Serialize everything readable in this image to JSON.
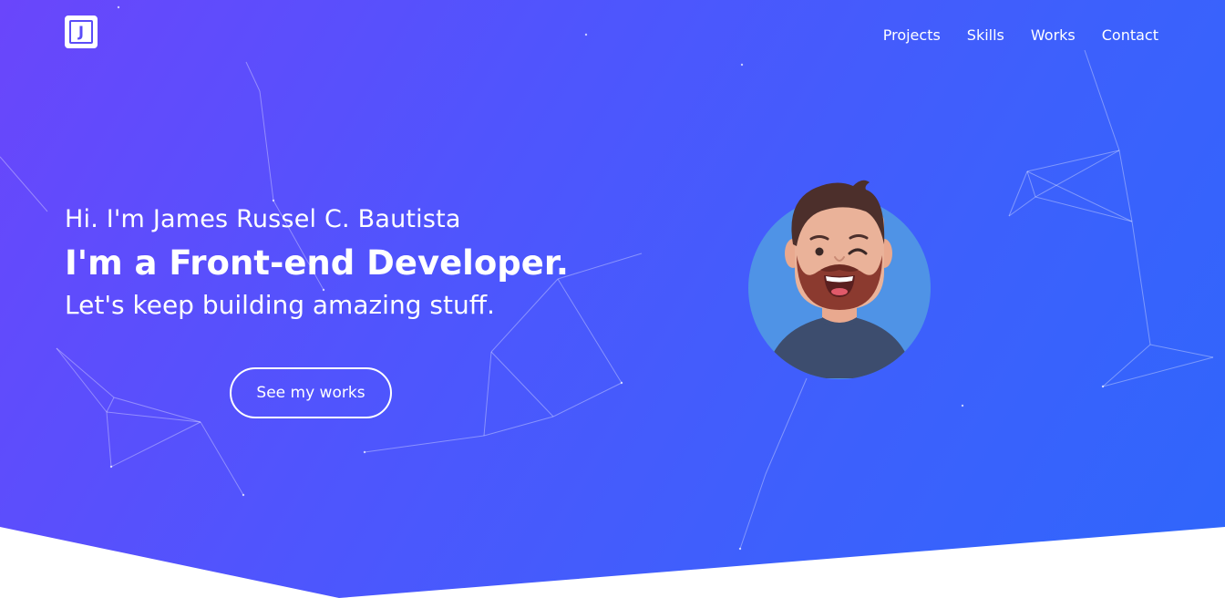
{
  "brand": {
    "logo_letter": "J"
  },
  "nav": {
    "items": [
      {
        "label": "Projects"
      },
      {
        "label": "Skills"
      },
      {
        "label": "Works"
      },
      {
        "label": "Contact"
      }
    ]
  },
  "hero": {
    "greeting": "Hi. I'm James Russel C. Bautista",
    "role": "I'm a Front-end Developer.",
    "tagline": "Let's keep building amazing stuff.",
    "cta_label": "See my works"
  },
  "colors": {
    "gradient_start": "#6a46fb",
    "gradient_end": "#2f66fb",
    "avatar_circle": "#4f93e6",
    "text": "#ffffff"
  },
  "icons": {
    "logo": "j-logo-icon",
    "avatar": "winking-developer-avatar"
  }
}
